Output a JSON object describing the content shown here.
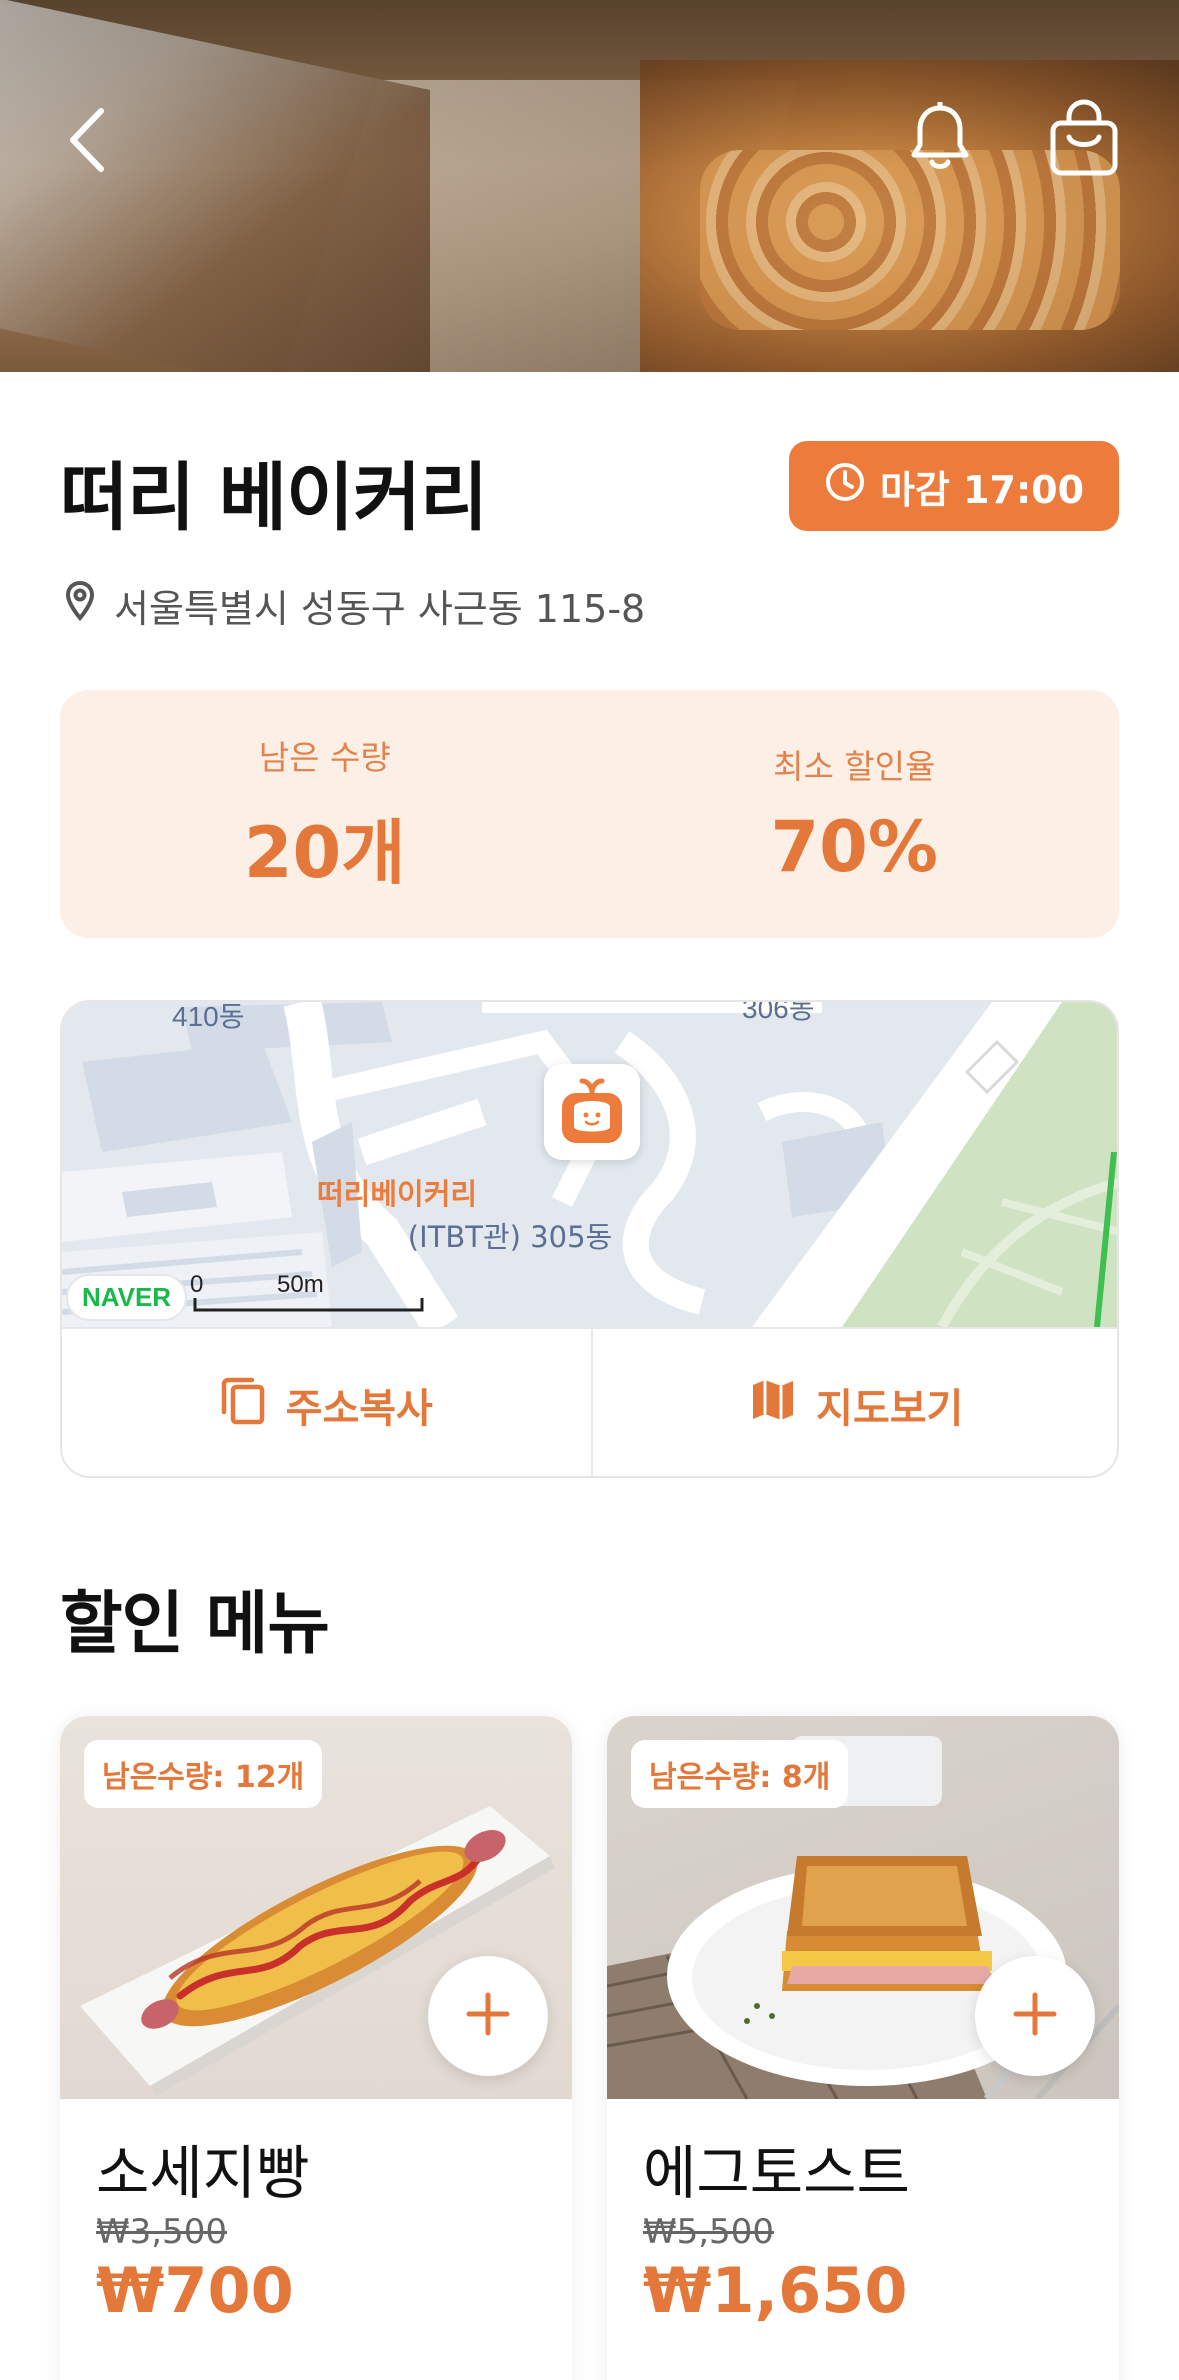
{
  "store": {
    "name": "떠리 베이커리",
    "close_label": "마감 17:00",
    "address": "서울특별시 성동구 사근동 115-8"
  },
  "stats": {
    "remaining_label": "남은 수량",
    "remaining_value": "20개",
    "discount_label": "최소 할인율",
    "discount_value": "70%"
  },
  "map": {
    "labels": [
      "410동",
      "306동"
    ],
    "marker_name": "떠리베이커리",
    "building_label": "(ITBT관) 305동",
    "provider": "NAVER",
    "scale_zero": "0",
    "scale_end": "50m",
    "copy_address_label": "주소복사",
    "view_map_label": "지도보기"
  },
  "menu": {
    "section_title": "할인 메뉴",
    "items": [
      {
        "stock": "남은수량: 12개",
        "name": "소세지빵",
        "original_price": "₩3,500",
        "price": "₩700"
      },
      {
        "stock": "남은수량: 8개",
        "name": "에그토스트",
        "original_price": "₩5,500",
        "price": "₩1,650"
      }
    ]
  },
  "colors": {
    "accent": "#ec7b3c",
    "accent_light": "#fcefe6"
  },
  "icons": [
    "back-arrow-icon",
    "bell-icon",
    "shopping-bag-icon",
    "clock-icon",
    "location-pin-icon",
    "copy-icon",
    "map-icon",
    "plus-icon",
    "bakery-marker-icon"
  ]
}
